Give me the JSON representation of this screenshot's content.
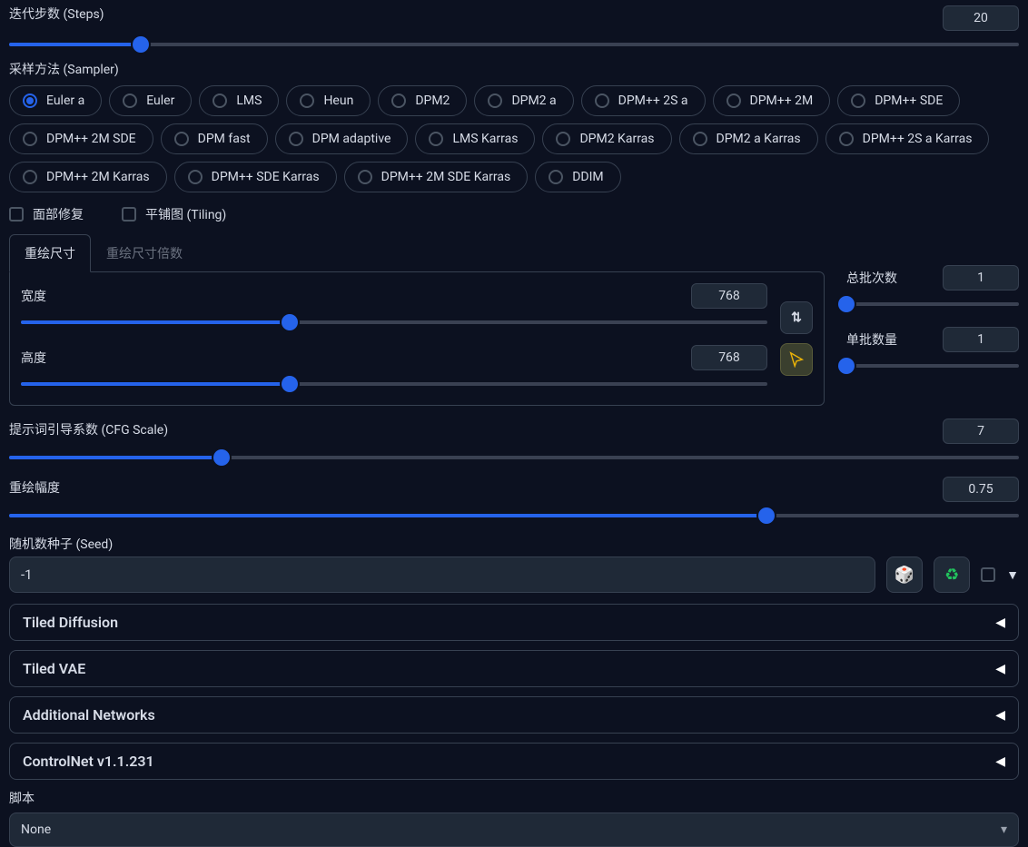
{
  "steps": {
    "label": "迭代步数 (Steps)",
    "value": 20,
    "fillPct": 13
  },
  "sampler": {
    "label": "采样方法 (Sampler)",
    "options": [
      "Euler a",
      "Euler",
      "LMS",
      "Heun",
      "DPM2",
      "DPM2 a",
      "DPM++ 2S a",
      "DPM++ 2M",
      "DPM++ SDE",
      "DPM++ 2M SDE",
      "DPM fast",
      "DPM adaptive",
      "LMS Karras",
      "DPM2 Karras",
      "DPM2 a Karras",
      "DPM++ 2S a Karras",
      "DPM++ 2M Karras",
      "DPM++ SDE Karras",
      "DPM++ 2M SDE Karras",
      "DDIM"
    ],
    "selected": "Euler a"
  },
  "checkboxes": {
    "faceRestore": "面部修复",
    "tiling": "平铺图 (Tiling)"
  },
  "sizeTabs": {
    "tab1": "重绘尺寸",
    "tab2": "重绘尺寸倍数"
  },
  "dims": {
    "width": {
      "label": "宽度",
      "value": 768,
      "fillPct": 36
    },
    "height": {
      "label": "高度",
      "value": 768,
      "fillPct": 36
    }
  },
  "batch": {
    "count": {
      "label": "总批次数",
      "value": 1,
      "fillPct": 0
    },
    "size": {
      "label": "单批数量",
      "value": 1,
      "fillPct": 0
    }
  },
  "cfg": {
    "label": "提示词引导系数 (CFG Scale)",
    "value": 7,
    "fillPct": 21
  },
  "denoise": {
    "label": "重绘幅度",
    "value": 0.75,
    "fillPct": 75
  },
  "seed": {
    "label": "随机数种子 (Seed)",
    "value": "-1"
  },
  "accordions": [
    "Tiled Diffusion",
    "Tiled VAE",
    "Additional Networks",
    "ControlNet v1.1.231"
  ],
  "script": {
    "label": "脚本",
    "value": "None"
  },
  "icons": {
    "swap": "⇅",
    "triangle": "▶",
    "dice": "🎲",
    "recycle": "♻",
    "caret": "▾",
    "triLeft": "◀"
  }
}
